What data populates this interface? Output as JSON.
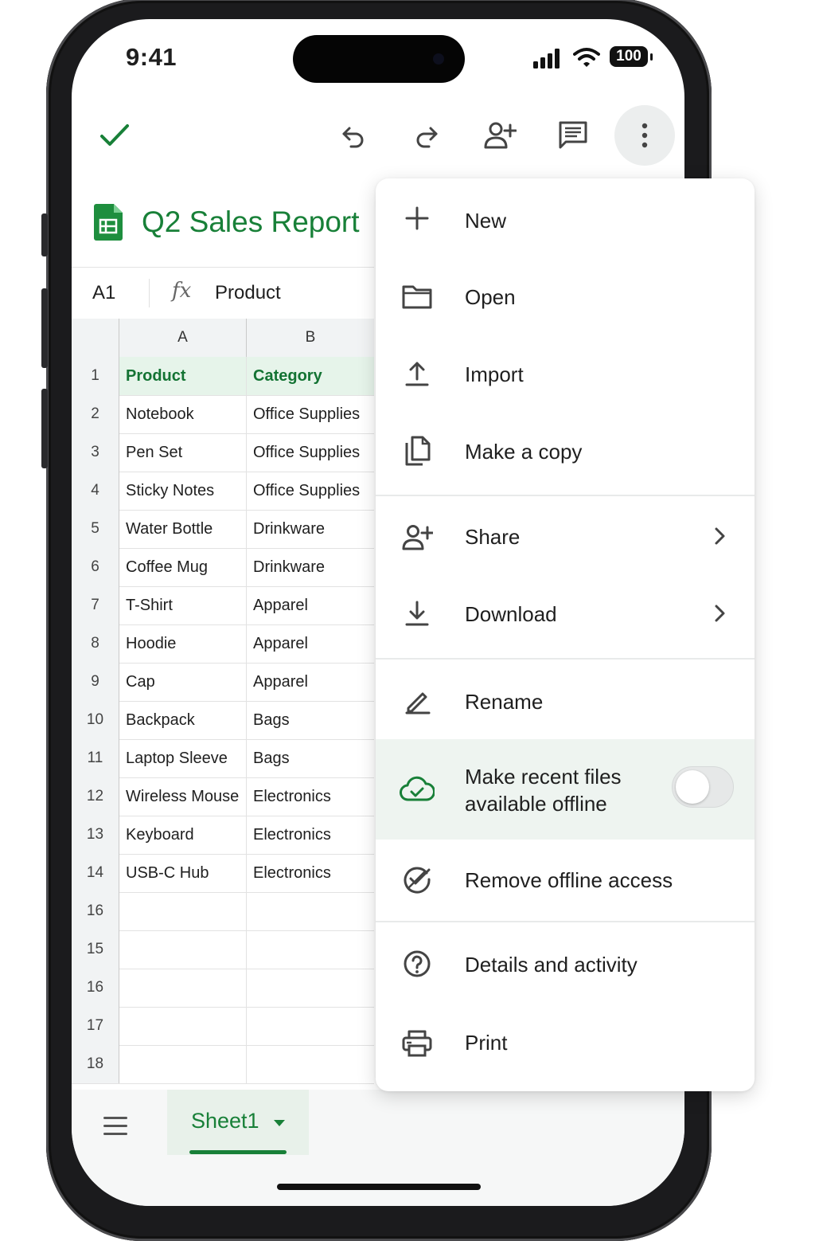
{
  "status_bar": {
    "time": "9:41",
    "battery": "100"
  },
  "toolbar": {
    "done_icon": "check-icon",
    "undo_icon": "undo-icon",
    "redo_icon": "redo-icon",
    "share_icon": "person-add-icon",
    "comments_icon": "comment-icon",
    "more_icon": "more-vert-icon"
  },
  "document": {
    "title": "Q2 Sales Report",
    "logo": "sheets-logo-icon"
  },
  "formula_bar": {
    "cell_ref": "A1",
    "fx_label": "fx",
    "value": "Product"
  },
  "grid": {
    "column_headers": [
      "A",
      "B"
    ],
    "rows": [
      {
        "num": "1",
        "a": "Product",
        "b": "Category"
      },
      {
        "num": "2",
        "a": "Notebook",
        "b": "Office Supplies"
      },
      {
        "num": "3",
        "a": "Pen Set",
        "b": "Office Supplies"
      },
      {
        "num": "4",
        "a": "Sticky Notes",
        "b": "Office Supplies"
      },
      {
        "num": "5",
        "a": "Water Bottle",
        "b": "Drinkware"
      },
      {
        "num": "6",
        "a": "Coffee Mug",
        "b": "Drinkware"
      },
      {
        "num": "7",
        "a": "T-Shirt",
        "b": "Apparel"
      },
      {
        "num": "8",
        "a": "Hoodie",
        "b": "Apparel"
      },
      {
        "num": "9",
        "a": "Cap",
        "b": "Apparel"
      },
      {
        "num": "10",
        "a": "Backpack",
        "b": "Bags"
      },
      {
        "num": "11",
        "a": "Laptop Sleeve",
        "b": "Bags"
      },
      {
        "num": "12",
        "a": "Wireless Mouse",
        "b": "Electronics"
      },
      {
        "num": "13",
        "a": "Keyboard",
        "b": "Electronics"
      },
      {
        "num": "14",
        "a": "USB-C Hub",
        "b": "Electronics"
      },
      {
        "num": "16",
        "a": "",
        "b": ""
      },
      {
        "num": "15",
        "a": "",
        "b": ""
      },
      {
        "num": "16",
        "a": "",
        "b": ""
      },
      {
        "num": "17",
        "a": "",
        "b": ""
      },
      {
        "num": "18",
        "a": "",
        "b": ""
      }
    ]
  },
  "bottom_bar": {
    "menu_icon": "hamburger-icon",
    "sheet_tab": "Sheet1",
    "caret_icon": "caret-down-icon"
  },
  "menu": {
    "items": [
      {
        "label": "New",
        "icon": "plus-icon"
      },
      {
        "label": "Open",
        "icon": "folder-icon"
      },
      {
        "label": "Import",
        "icon": "upload-icon"
      },
      {
        "label": "Make a copy",
        "icon": "copy-icon"
      },
      {
        "label": "Share",
        "icon": "person-add-icon",
        "submenu": true
      },
      {
        "label": "Download",
        "icon": "download-icon",
        "submenu": true
      },
      {
        "label": "Rename",
        "icon": "pencil-icon"
      },
      {
        "label_line1": "Make recent files",
        "label_line2": "available offline",
        "icon": "cloud-check-icon",
        "toggle": "off"
      },
      {
        "label": "Remove offline access",
        "icon": "offline-check-icon"
      },
      {
        "label": "Details and activity",
        "icon": "help-circle-icon"
      },
      {
        "label": "Print",
        "icon": "printer-icon"
      }
    ]
  },
  "colors": {
    "sheets_green": "#188038",
    "header_fill": "#e6f4ea",
    "highlight_fill": "#eef4f0"
  }
}
